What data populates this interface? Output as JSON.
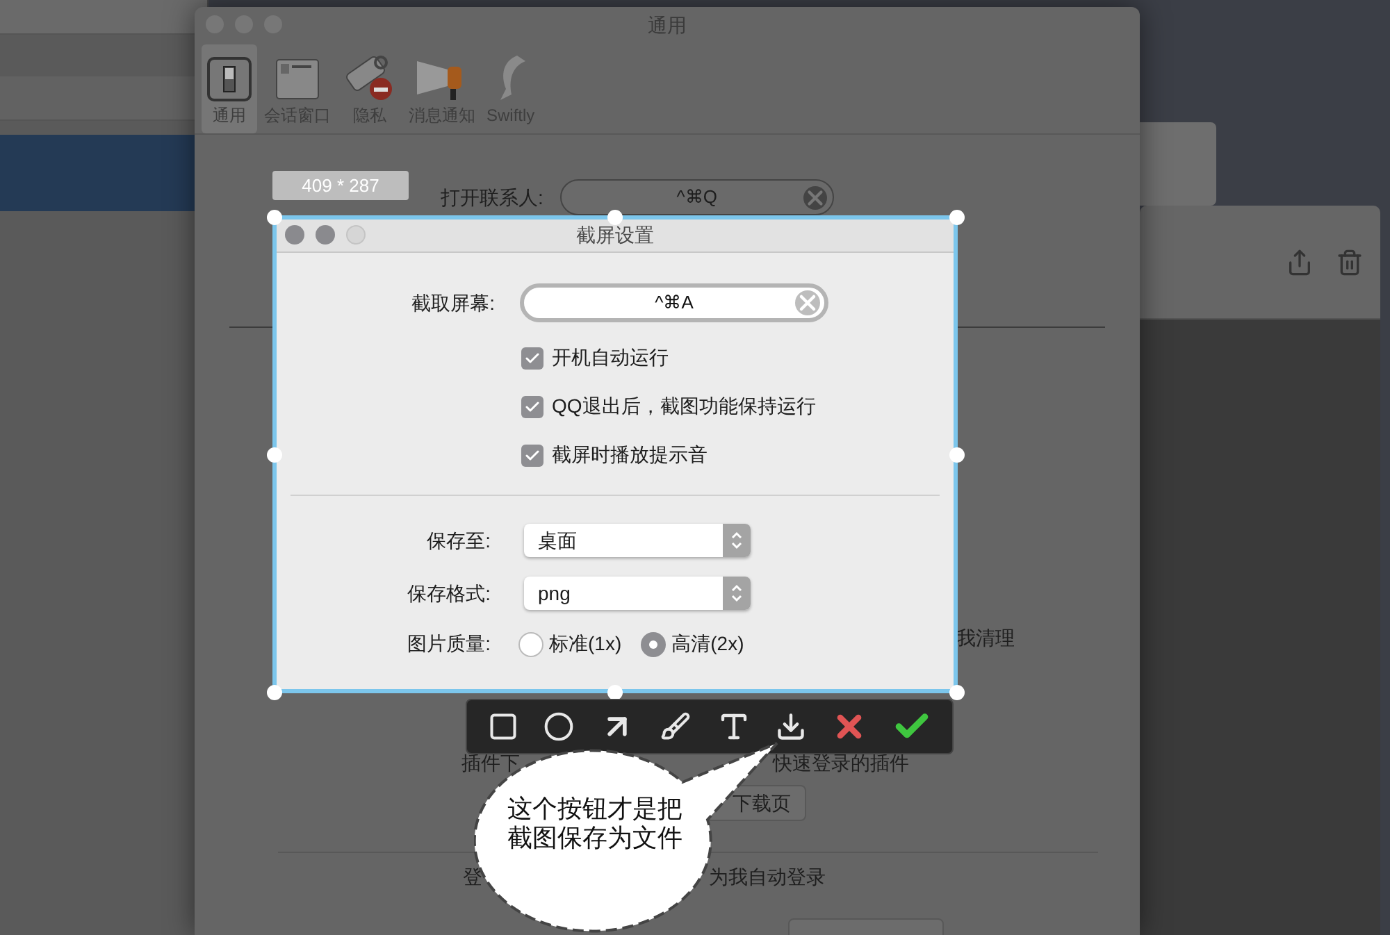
{
  "prefs_window": {
    "title": "通用",
    "tabs": [
      {
        "kind": "general",
        "label": "通用",
        "selected": true
      },
      {
        "kind": "chat",
        "label": "会话窗口",
        "selected": false
      },
      {
        "kind": "privacy",
        "label": "隐私",
        "selected": false
      },
      {
        "kind": "notify",
        "label": "消息通知",
        "selected": false
      },
      {
        "kind": "swiftly",
        "label": "Swiftly",
        "selected": false
      }
    ],
    "contacts_label": "打开联系人:",
    "contacts_value": "^⌘Q",
    "fragment_cleanup": "我清理",
    "fragment_plugin": "插件下",
    "fragment_plugin_2": "快速登录的插件",
    "download_button": "下载页",
    "fragment_login": "登",
    "fragment_login_2": "为我自动登录"
  },
  "selection": {
    "size": "409 * 287"
  },
  "dialog": {
    "title": "截屏设置",
    "shortcut_label": "截取屏幕:",
    "shortcut_value": "^⌘A",
    "options": [
      {
        "label": "开机自动运行",
        "checked": true
      },
      {
        "label": "QQ退出后，截图功能保持运行",
        "checked": true
      },
      {
        "label": "截屏时播放提示音",
        "checked": true
      }
    ],
    "save_to_label": "保存至:",
    "save_to_value": "桌面",
    "format_label": "保存格式:",
    "format_value": "png",
    "quality_label": "图片质量:",
    "quality_options": [
      {
        "label": "标准(1x)",
        "selected": false
      },
      {
        "label": "高清(2x)",
        "selected": true
      }
    ]
  },
  "toolbar": [
    {
      "kind": "rectangle"
    },
    {
      "kind": "ellipse"
    },
    {
      "kind": "arrow"
    },
    {
      "kind": "brush"
    },
    {
      "kind": "text"
    },
    {
      "kind": "save"
    },
    {
      "kind": "cancel"
    },
    {
      "kind": "confirm"
    }
  ],
  "callout": {
    "text": "这个按钮才是把截图保存为文件"
  }
}
